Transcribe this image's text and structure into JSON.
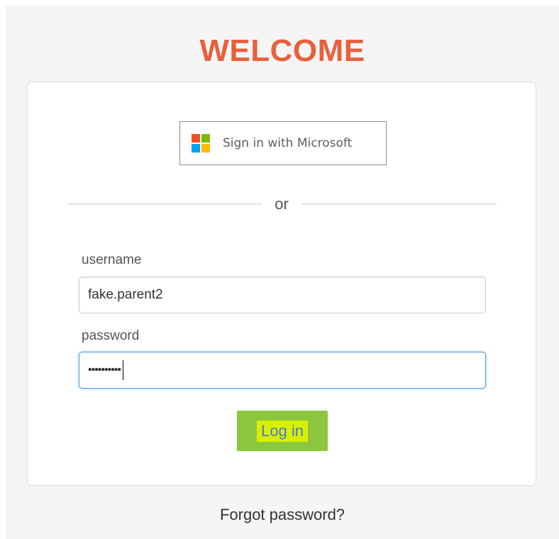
{
  "header": {
    "title": "WELCOME"
  },
  "sso": {
    "microsoft_label": "Sign in with Microsoft",
    "logo_icon": "microsoft-logo-icon",
    "logo_colors": [
      "#f25022",
      "#7fba00",
      "#00a4ef",
      "#ffb900"
    ]
  },
  "divider": {
    "text": "or"
  },
  "form": {
    "username_label": "username",
    "username_value": "fake.parent2",
    "password_label": "password",
    "password_masked": "••••••••••",
    "login_label": "Log in"
  },
  "footer": {
    "forgot_label": "Forgot password?"
  },
  "colors": {
    "title": "#e8603c",
    "login_button": "#8cc63e",
    "focus_border": "#4da3e6",
    "page_background": "#f5f5f5"
  }
}
